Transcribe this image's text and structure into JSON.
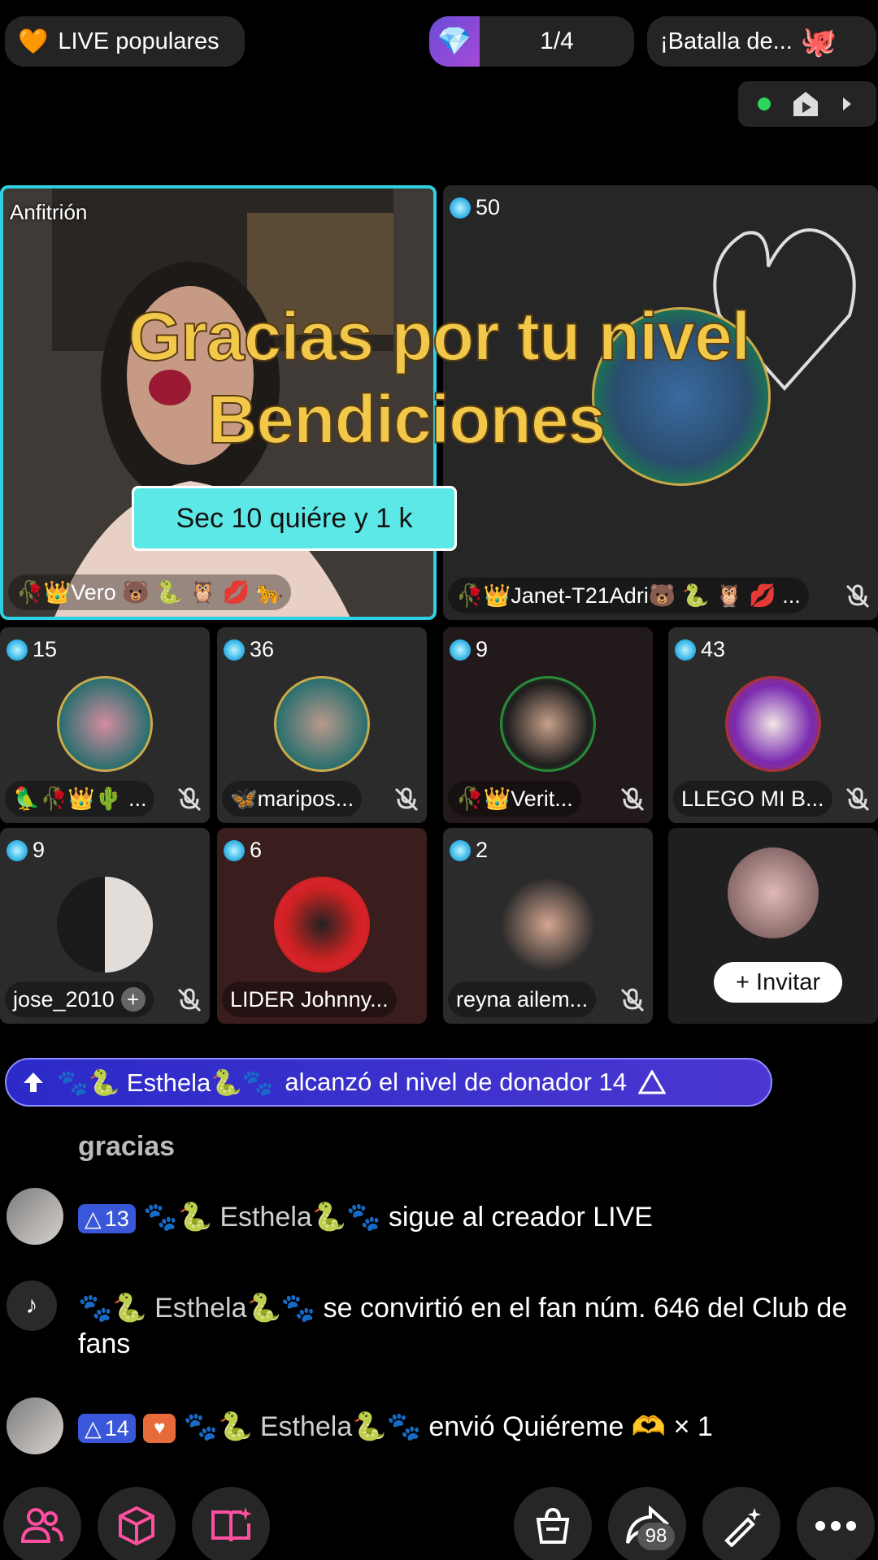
{
  "top_bar": {
    "live_label": "LIVE populares",
    "rank_count": "1/4",
    "battle_label": "¡Batalla de..."
  },
  "stream": {
    "host": {
      "label": "Anfitrión",
      "name": "🥀👑Vero 🐻 🐍 🦉 💋 🐆"
    },
    "second": {
      "gems": "50",
      "name": "🥀👑Janet-T21Adri🐻 🐍 🦉 💋 ..."
    },
    "overlay_line1": "Gracias por tu nivel",
    "overlay_line2": "Bendiciones",
    "sec_banner": "Sec 10 quiére y 1 k",
    "guests": [
      {
        "gems": "15",
        "name": "🦜🥀👑🌵 ..."
      },
      {
        "gems": "36",
        "name": "🦋maripos..."
      },
      {
        "gems": "9",
        "name": "🥀👑Verit..."
      },
      {
        "gems": "43",
        "name": "LLEGO MI B..."
      },
      {
        "gems": "9",
        "name": "jose_2010"
      },
      {
        "gems": "6",
        "name": "LIDER Johnny..."
      },
      {
        "gems": "2",
        "name": "reyna ailem..."
      }
    ],
    "invite_label": "+ Invitar"
  },
  "level_banner": {
    "user": "🐾🐍 Esthela🐍🐾",
    "text": "alcanzó el nivel de donador 14"
  },
  "chat": {
    "partial": "gracias",
    "items": [
      {
        "level": "13",
        "user": "🐾🐍 Esthela🐍🐾",
        "text": "sigue al creador LIVE"
      },
      {
        "user": "🐾🐍 Esthela🐍🐾",
        "text": "se convirtió en el fan núm. 646 del Club de fans"
      },
      {
        "level": "14",
        "user": "🐾🐍 Esthela🐍🐾",
        "text": "envió Quiéreme 🫶 × 1"
      }
    ]
  },
  "bottom": {
    "share_count": "98"
  },
  "colors": {
    "host_border": "#2fd0e3",
    "overlay_text": "#f2c84a",
    "level_banner": "#2b2ac8"
  },
  "icons": [
    "heart-icon",
    "diamond-icon",
    "octopus-icon",
    "live-dot-icon",
    "play-icon",
    "chevron-right-icon",
    "gem-icon",
    "mute-icon",
    "plus-icon",
    "level-up-icon",
    "people-icon",
    "box-icon",
    "book-icon",
    "bag-icon",
    "share-icon",
    "magic-wand-icon",
    "more-icon"
  ]
}
